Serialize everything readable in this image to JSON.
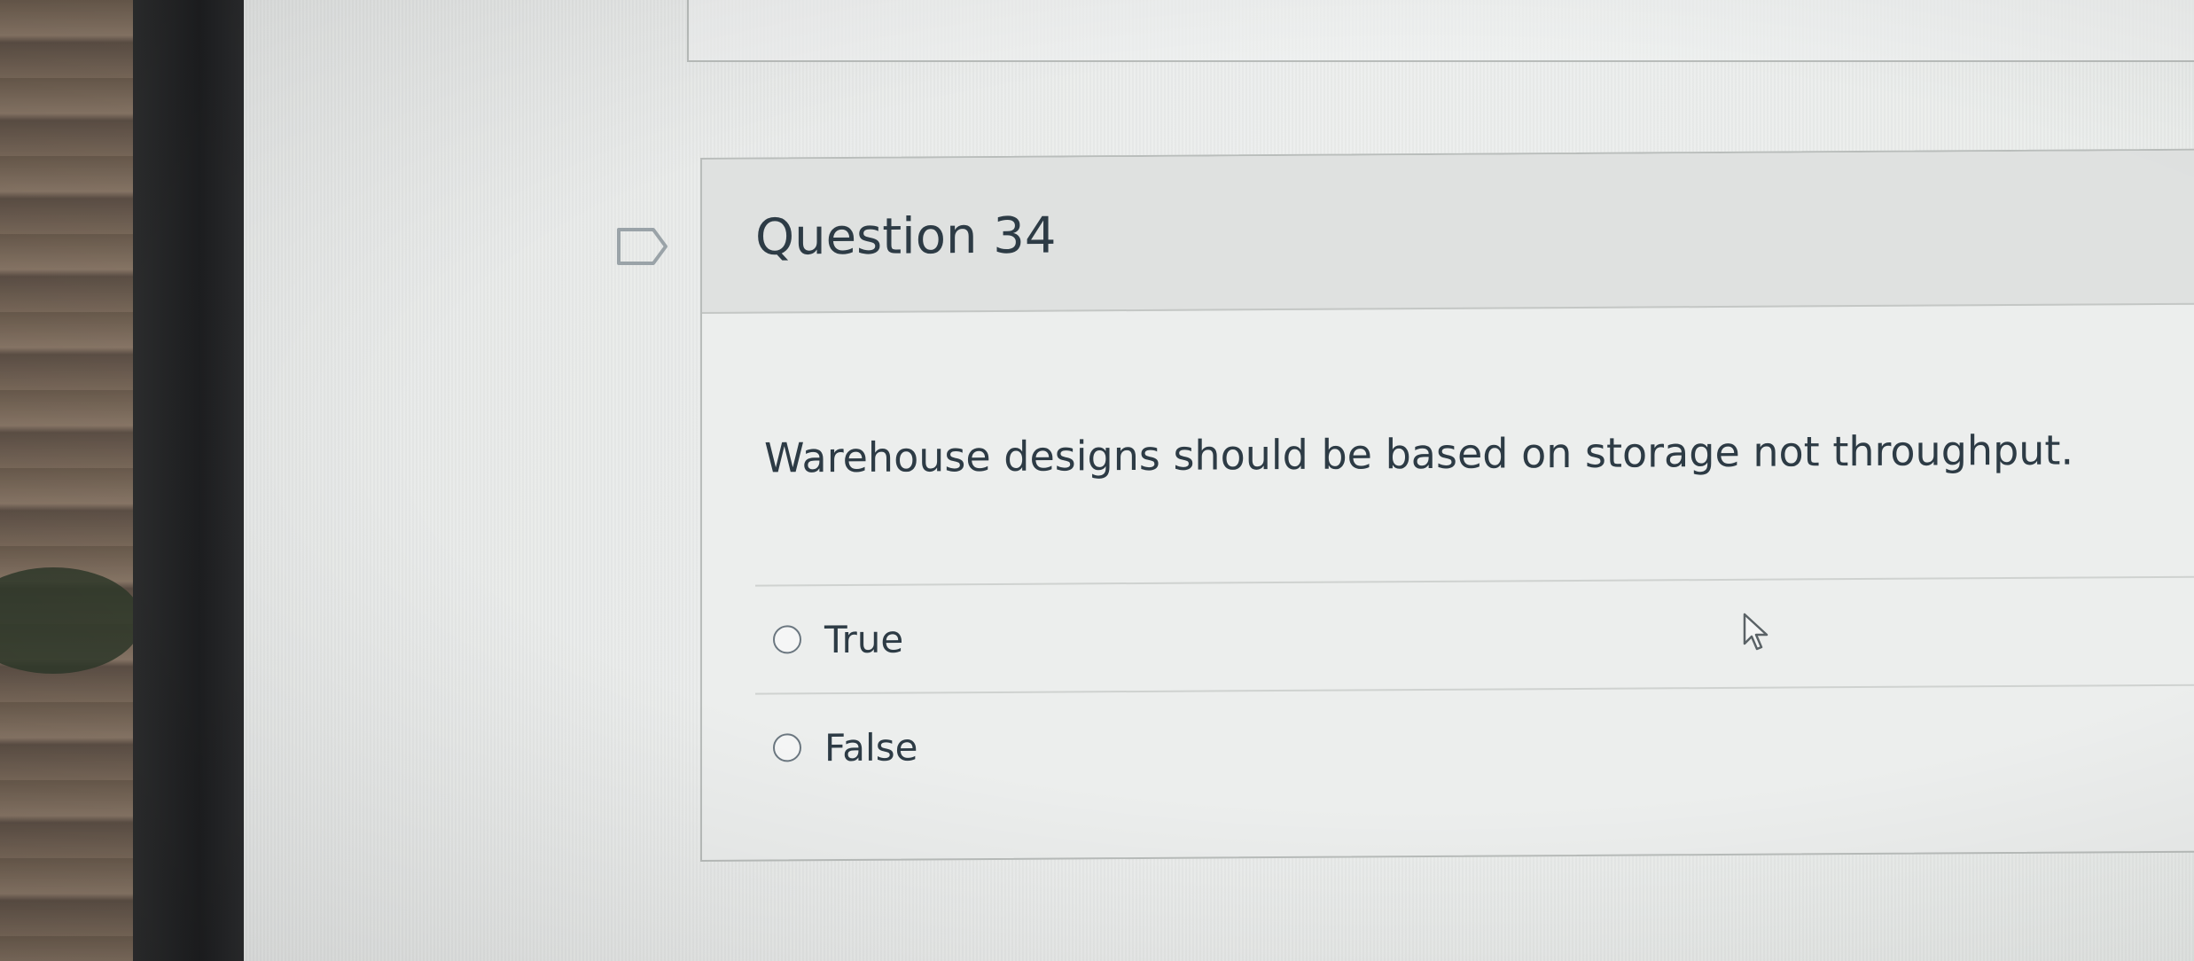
{
  "question": {
    "title": "Question 34",
    "text": "Warehouse designs should be based on storage not throughput."
  },
  "answers": [
    {
      "label": "True",
      "selected": false
    },
    {
      "label": "False",
      "selected": false
    }
  ],
  "icons": {
    "flag": "flag-icon",
    "radio": "radio-unselected-icon",
    "cursor": "mouse-pointer-icon"
  },
  "colors": {
    "text": "#2d3b45",
    "header_bg": "#dfe1e0",
    "border": "#b9bdbb"
  }
}
